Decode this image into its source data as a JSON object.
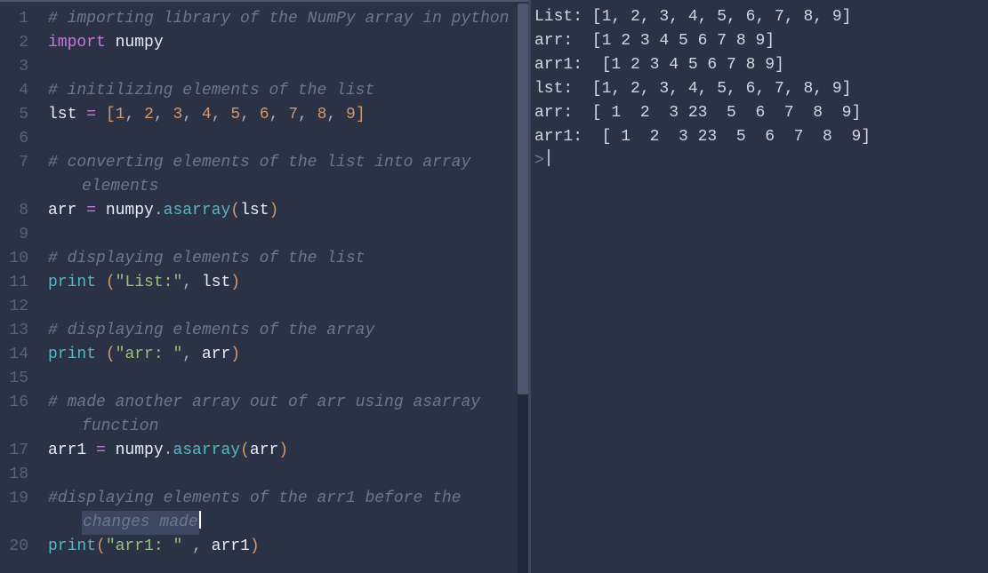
{
  "editor": {
    "lines": [
      {
        "n": 1,
        "tokens": [
          {
            "c": "cm",
            "t": "# importing library of the NumPy array in python"
          }
        ]
      },
      {
        "n": 2,
        "tokens": [
          {
            "c": "kw",
            "t": "import"
          },
          {
            "c": "id",
            "t": " numpy"
          }
        ]
      },
      {
        "n": 3,
        "tokens": []
      },
      {
        "n": 4,
        "tokens": [
          {
            "c": "cm",
            "t": "# initilizing elements of the list"
          }
        ]
      },
      {
        "n": 5,
        "tokens": [
          {
            "c": "id",
            "t": "lst "
          },
          {
            "c": "op",
            "t": "="
          },
          {
            "c": "id",
            "t": " "
          },
          {
            "c": "br",
            "t": "["
          },
          {
            "c": "num",
            "t": "1"
          },
          {
            "c": "pun",
            "t": ", "
          },
          {
            "c": "num",
            "t": "2"
          },
          {
            "c": "pun",
            "t": ", "
          },
          {
            "c": "num",
            "t": "3"
          },
          {
            "c": "pun",
            "t": ", "
          },
          {
            "c": "num",
            "t": "4"
          },
          {
            "c": "pun",
            "t": ", "
          },
          {
            "c": "num",
            "t": "5"
          },
          {
            "c": "pun",
            "t": ", "
          },
          {
            "c": "num",
            "t": "6"
          },
          {
            "c": "pun",
            "t": ", "
          },
          {
            "c": "num",
            "t": "7"
          },
          {
            "c": "pun",
            "t": ", "
          },
          {
            "c": "num",
            "t": "8"
          },
          {
            "c": "pun",
            "t": ", "
          },
          {
            "c": "num",
            "t": "9"
          },
          {
            "c": "br",
            "t": "]"
          }
        ]
      },
      {
        "n": 6,
        "tokens": []
      },
      {
        "n": 7,
        "tokens": [
          {
            "c": "cm",
            "t": "# converting elements of the list into array "
          }
        ],
        "wrap": [
          {
            "c": "cm",
            "t": "elements"
          }
        ]
      },
      {
        "n": 8,
        "tokens": [
          {
            "c": "id",
            "t": "arr "
          },
          {
            "c": "op",
            "t": "="
          },
          {
            "c": "id",
            "t": " numpy"
          },
          {
            "c": "pun",
            "t": "."
          },
          {
            "c": "fn",
            "t": "asarray"
          },
          {
            "c": "br",
            "t": "("
          },
          {
            "c": "id",
            "t": "lst"
          },
          {
            "c": "br",
            "t": ")"
          }
        ]
      },
      {
        "n": 9,
        "tokens": []
      },
      {
        "n": 10,
        "tokens": [
          {
            "c": "cm",
            "t": "# displaying elements of the list"
          }
        ]
      },
      {
        "n": 11,
        "tokens": [
          {
            "c": "fn",
            "t": "print"
          },
          {
            "c": "id",
            "t": " "
          },
          {
            "c": "br",
            "t": "("
          },
          {
            "c": "str",
            "t": "\"List:\""
          },
          {
            "c": "pun",
            "t": ", "
          },
          {
            "c": "id",
            "t": "lst"
          },
          {
            "c": "br",
            "t": ")"
          }
        ]
      },
      {
        "n": 12,
        "tokens": []
      },
      {
        "n": 13,
        "tokens": [
          {
            "c": "cm",
            "t": "# displaying elements of the array"
          }
        ]
      },
      {
        "n": 14,
        "tokens": [
          {
            "c": "fn",
            "t": "print"
          },
          {
            "c": "id",
            "t": " "
          },
          {
            "c": "br",
            "t": "("
          },
          {
            "c": "str",
            "t": "\"arr: \""
          },
          {
            "c": "pun",
            "t": ", "
          },
          {
            "c": "id",
            "t": "arr"
          },
          {
            "c": "br",
            "t": ")"
          }
        ]
      },
      {
        "n": 15,
        "tokens": []
      },
      {
        "n": 16,
        "tokens": [
          {
            "c": "cm",
            "t": "# made another array out of arr using asarray "
          }
        ],
        "wrap": [
          {
            "c": "cm",
            "t": "function"
          }
        ]
      },
      {
        "n": 17,
        "tokens": [
          {
            "c": "id",
            "t": "arr1 "
          },
          {
            "c": "op",
            "t": "="
          },
          {
            "c": "id",
            "t": " numpy"
          },
          {
            "c": "pun",
            "t": "."
          },
          {
            "c": "fn",
            "t": "asarray"
          },
          {
            "c": "br",
            "t": "("
          },
          {
            "c": "id",
            "t": "arr"
          },
          {
            "c": "br",
            "t": ")"
          }
        ]
      },
      {
        "n": 18,
        "tokens": []
      },
      {
        "n": 19,
        "tokens": [
          {
            "c": "cm",
            "t": "#displaying elements of the arr1 before the "
          }
        ],
        "wrap": [
          {
            "c": "cm",
            "t": "changes made"
          }
        ],
        "wrapSelected": true,
        "caretAfterWrap": true
      },
      {
        "n": 20,
        "tokens": [
          {
            "c": "fn",
            "t": "print"
          },
          {
            "c": "br",
            "t": "("
          },
          {
            "c": "str",
            "t": "\"arr1: \""
          },
          {
            "c": "id",
            "t": " "
          },
          {
            "c": "pun",
            "t": ", "
          },
          {
            "c": "id",
            "t": "arr1"
          },
          {
            "c": "br",
            "t": ")"
          }
        ]
      }
    ]
  },
  "output": {
    "lines": [
      "List: [1, 2, 3, 4, 5, 6, 7, 8, 9]",
      "arr:  [1 2 3 4 5 6 7 8 9]",
      "arr1:  [1 2 3 4 5 6 7 8 9]",
      "lst:  [1, 2, 3, 4, 5, 6, 7, 8, 9]",
      "arr:  [ 1  2  3 23  5  6  7  8  9]",
      "arr1:  [ 1  2  3 23  5  6  7  8  9]"
    ],
    "prompt": ">"
  }
}
